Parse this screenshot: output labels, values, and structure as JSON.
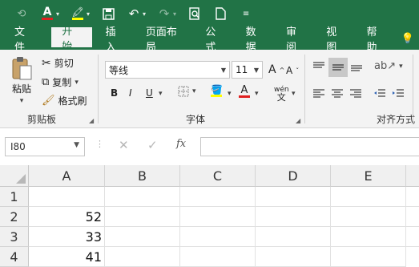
{
  "qat": {
    "items": [
      "font-color-icon",
      "highlight-color-icon",
      "save-icon",
      "undo-icon",
      "redo-icon",
      "print-preview-icon",
      "new-file-icon",
      "customize-icon"
    ]
  },
  "tabs": [
    "文件",
    "开始",
    "插入",
    "页面布局",
    "公式",
    "数据",
    "审阅",
    "视图",
    "帮助"
  ],
  "active_tab": "开始",
  "ribbon": {
    "clipboard": {
      "paste": "粘贴",
      "cut": "剪切",
      "copy": "复制",
      "format_painter": "格式刷",
      "label": "剪贴板"
    },
    "font": {
      "name": "等线",
      "size": "11",
      "bold": "B",
      "italic": "I",
      "underline": "U",
      "phonetic": "wén",
      "label": "字体"
    },
    "alignment": {
      "label": "对齐方式"
    }
  },
  "formula_bar": {
    "name_box": "I80",
    "fx": "fx",
    "formula": ""
  },
  "sheet": {
    "columns": [
      "A",
      "B",
      "C",
      "D",
      "E"
    ],
    "rows": [
      {
        "num": "1",
        "a": ""
      },
      {
        "num": "2",
        "a": "52"
      },
      {
        "num": "3",
        "a": "33"
      },
      {
        "num": "4",
        "a": "41"
      }
    ]
  },
  "colors": {
    "brand": "#217346",
    "font_red": "#e02020",
    "highlight_yellow": "#ffff00"
  }
}
